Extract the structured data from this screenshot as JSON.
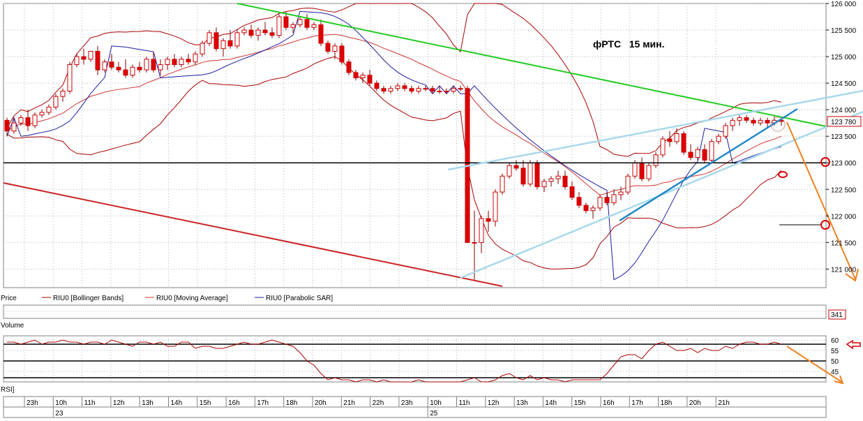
{
  "chart_data": {
    "type": "candlestick",
    "title": "фРТС   15 мин.",
    "price_axis": {
      "ylim": [
        120650,
        126000
      ],
      "ticks": [
        "126 000",
        "125 500",
        "125 000",
        "124 500",
        "124 000",
        "123 500",
        "123 000",
        "122 500",
        "122 000",
        "121 500",
        "121 000"
      ],
      "tick_values": [
        126000,
        125500,
        125000,
        124500,
        124000,
        123500,
        123000,
        122500,
        122000,
        121500,
        121000
      ],
      "current_price_label": "123 780",
      "current_price": 123780,
      "horizontal_level": 123000,
      "target_level": 121850
    },
    "legend": [
      {
        "label": "Price",
        "color": "#000000"
      },
      {
        "label": "RIU0 [Bollinger Bands]",
        "color": "#aa0000"
      },
      {
        "label": "RIU0 [Moving Average]",
        "color": "#cc3333"
      },
      {
        "label": "RIU0 [Parabolic SAR]",
        "color": "#1a1aa0"
      }
    ],
    "volume_panel": {
      "label": "Volume",
      "value_label": "341"
    },
    "rsi_panel": {
      "label": "RSI]",
      "ticks": [
        "60",
        "55",
        "50",
        "45"
      ],
      "tick_values": [
        60,
        55,
        50,
        45
      ],
      "levels": [
        58,
        50,
        42
      ],
      "ylim": [
        40,
        62
      ]
    },
    "time_axis": {
      "labels": [
        "23h",
        "10h",
        "11h",
        "12h",
        "13h",
        "14h",
        "15h",
        "16h",
        "17h",
        "18h",
        "20h",
        "21h",
        "22h",
        "23h",
        "10h",
        "11h",
        "12h",
        "13h",
        "14h",
        "15h",
        "16h",
        "17h",
        "18h",
        "20h",
        "21h"
      ],
      "dates": [
        {
          "label": "23",
          "at_label_index": 1
        },
        {
          "label": "25",
          "at_label_index": 14
        }
      ]
    },
    "candles": [
      [
        123800,
        123850,
        123500,
        123600
      ],
      [
        123600,
        123850,
        123550,
        123750
      ],
      [
        123750,
        123900,
        123700,
        123850
      ],
      [
        123850,
        124000,
        123600,
        123700
      ],
      [
        123700,
        123950,
        123650,
        123900
      ],
      [
        123900,
        124000,
        123850,
        123950
      ],
      [
        123950,
        124100,
        123900,
        124050
      ],
      [
        124050,
        124300,
        124000,
        124250
      ],
      [
        124250,
        124400,
        124150,
        124350
      ],
      [
        124350,
        124900,
        124300,
        124850
      ],
      [
        124850,
        125050,
        124800,
        125000
      ],
      [
        125000,
        125150,
        124850,
        124950
      ],
      [
        124950,
        125100,
        124900,
        125100
      ],
      [
        125100,
        125200,
        124650,
        124750
      ],
      [
        124750,
        124950,
        124700,
        124900
      ],
      [
        124900,
        125050,
        124750,
        124800
      ],
      [
        124800,
        124900,
        124700,
        124750
      ],
      [
        124750,
        124950,
        124600,
        124650
      ],
      [
        124650,
        124850,
        124600,
        124800
      ],
      [
        124800,
        124900,
        124700,
        124750
      ],
      [
        124750,
        125000,
        124700,
        124950
      ],
      [
        124950,
        125100,
        124700,
        124750
      ],
      [
        124750,
        124950,
        124650,
        124850
      ],
      [
        124850,
        125000,
        124750,
        124950
      ],
      [
        124950,
        125050,
        124800,
        124850
      ],
      [
        124850,
        125000,
        124800,
        124950
      ],
      [
        124950,
        125050,
        124850,
        124900
      ],
      [
        124900,
        125100,
        124850,
        125050
      ],
      [
        125050,
        125300,
        125000,
        125250
      ],
      [
        125250,
        125500,
        125200,
        125450
      ],
      [
        125450,
        125550,
        125100,
        125150
      ],
      [
        125150,
        125350,
        125000,
        125300
      ],
      [
        125300,
        125500,
        125150,
        125200
      ],
      [
        125200,
        125500,
        125150,
        125450
      ],
      [
        125450,
        125550,
        125400,
        125500
      ],
      [
        125500,
        125600,
        125350,
        125400
      ],
      [
        125400,
        125550,
        125300,
        125500
      ],
      [
        125500,
        125650,
        125400,
        125450
      ],
      [
        125450,
        125550,
        125350,
        125400
      ],
      [
        125400,
        125800,
        125350,
        125750
      ],
      [
        125750,
        125850,
        125500,
        125550
      ],
      [
        125550,
        125650,
        125450,
        125600
      ],
      [
        125600,
        125750,
        125550,
        125700
      ],
      [
        125700,
        125800,
        125500,
        125550
      ],
      [
        125550,
        125650,
        125500,
        125600
      ],
      [
        125600,
        125700,
        125200,
        125250
      ],
      [
        125250,
        125300,
        125050,
        125100
      ],
      [
        125100,
        125250,
        124950,
        125200
      ],
      [
        125200,
        125250,
        124850,
        124900
      ],
      [
        124900,
        124950,
        124650,
        124700
      ],
      [
        124700,
        124750,
        124550,
        124600
      ],
      [
        124600,
        124700,
        124500,
        124650
      ],
      [
        124650,
        124750,
        124450,
        124500
      ],
      [
        124500,
        124550,
        124350,
        124400
      ],
      [
        124400,
        124450,
        124300,
        124350
      ],
      [
        124350,
        124450,
        124300,
        124400
      ],
      [
        124400,
        124500,
        124350,
        124450
      ],
      [
        124450,
        124500,
        124350,
        124400
      ],
      [
        124400,
        124450,
        124300,
        124350
      ],
      [
        124350,
        124450,
        124300,
        124400
      ],
      [
        124400,
        124450,
        124350,
        124400
      ],
      [
        124400,
        124450,
        124300,
        124350
      ],
      [
        124350,
        124450,
        124300,
        124350
      ],
      [
        124350,
        124400,
        124300,
        124350
      ],
      [
        124350,
        124450,
        124300,
        124400
      ],
      [
        124400,
        124450,
        124350,
        124400
      ],
      [
        124400,
        124450,
        123500,
        121500
      ],
      [
        121500,
        122100,
        120800,
        121500
      ],
      [
        121500,
        122000,
        121300,
        121950
      ],
      [
        121950,
        122100,
        121700,
        121900
      ],
      [
        121900,
        122500,
        121800,
        122450
      ],
      [
        122450,
        122800,
        122400,
        122750
      ],
      [
        122750,
        123000,
        122700,
        122950
      ],
      [
        122950,
        123050,
        122850,
        122900
      ],
      [
        122900,
        123050,
        122550,
        122600
      ],
      [
        122600,
        123050,
        122550,
        123000
      ],
      [
        123000,
        123050,
        122500,
        122550
      ],
      [
        122550,
        122700,
        122450,
        122650
      ],
      [
        122650,
        122750,
        122550,
        122700
      ],
      [
        122700,
        122850,
        122600,
        122750
      ],
      [
        122750,
        122850,
        122500,
        122550
      ],
      [
        122550,
        122650,
        122300,
        122350
      ],
      [
        122350,
        122450,
        122150,
        122200
      ],
      [
        122200,
        122250,
        122050,
        122100
      ],
      [
        122100,
        122200,
        121950,
        122150
      ],
      [
        122150,
        122400,
        122100,
        122350
      ],
      [
        122350,
        122450,
        122200,
        122250
      ],
      [
        122250,
        122500,
        122200,
        122400
      ],
      [
        122400,
        122550,
        122300,
        122450
      ],
      [
        122450,
        122800,
        122400,
        122750
      ],
      [
        122750,
        123050,
        122700,
        123000
      ],
      [
        123000,
        123100,
        122650,
        122700
      ],
      [
        122700,
        123000,
        122650,
        122950
      ],
      [
        122950,
        123200,
        122900,
        123150
      ],
      [
        123150,
        123500,
        123100,
        123450
      ],
      [
        123450,
        123600,
        123300,
        123400
      ],
      [
        123400,
        123650,
        123350,
        123550
      ],
      [
        123550,
        123600,
        123150,
        123200
      ],
      [
        123200,
        123350,
        123050,
        123100
      ],
      [
        123100,
        123300,
        123050,
        123250
      ],
      [
        123250,
        123350,
        123000,
        123050
      ],
      [
        123050,
        123450,
        123000,
        123400
      ],
      [
        123400,
        123550,
        123350,
        123500
      ],
      [
        123500,
        123750,
        123450,
        123700
      ],
      [
        123700,
        123850,
        123600,
        123800
      ],
      [
        123800,
        123900,
        123700,
        123850
      ],
      [
        123850,
        123900,
        123750,
        123800
      ],
      [
        123800,
        123850,
        123700,
        123750
      ],
      [
        123750,
        123850,
        123700,
        123800
      ],
      [
        123800,
        123850,
        123650,
        123750
      ],
      [
        123750,
        123900,
        123700,
        123800
      ],
      [
        123800,
        123850,
        123700,
        123780
      ]
    ],
    "rsi": [
      59,
      59,
      58,
      59,
      60,
      58,
      59,
      59,
      60,
      59,
      59,
      58,
      59,
      59,
      58,
      60,
      59,
      58,
      57,
      59,
      59,
      58,
      59,
      57,
      57,
      59,
      59,
      56,
      57,
      57,
      56,
      56,
      57,
      58,
      59,
      58,
      58,
      59,
      60,
      59,
      58,
      57,
      54,
      50,
      48,
      44,
      41,
      42,
      41,
      41,
      40,
      41,
      41,
      40,
      41,
      40,
      40,
      40,
      40,
      41,
      40,
      40,
      40,
      40,
      40,
      40,
      41,
      42,
      40,
      40,
      41,
      43,
      44,
      42,
      41,
      43,
      41,
      42,
      41,
      41,
      40,
      41,
      41,
      41,
      41,
      41,
      44,
      48,
      52,
      53,
      53,
      51,
      55,
      58,
      59,
      57,
      55,
      55,
      56,
      54,
      56,
      55,
      55,
      57,
      56,
      58,
      59,
      59,
      58,
      58,
      59,
      58
    ],
    "annotations": [
      "green-downtrend-line",
      "red-support-line",
      "light-blue-channel-upper",
      "light-blue-channel-lower",
      "blue-rising-trendline",
      "orange-forecast-arrow",
      "rsi-forecast-arrow",
      "rsi-level-arrow"
    ]
  }
}
